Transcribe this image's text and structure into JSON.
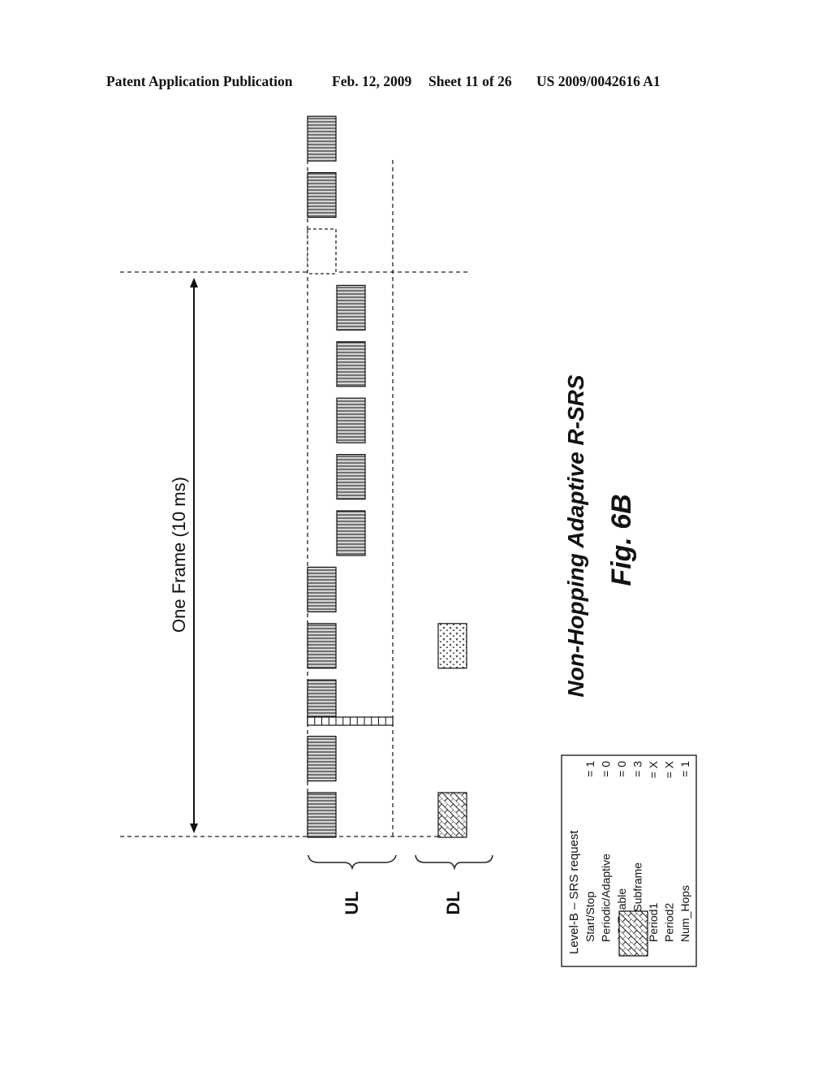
{
  "header": {
    "publication": "Patent Application Publication",
    "date": "Feb. 12, 2009",
    "sheet": "Sheet 11 of 26",
    "number": "US 2009/0042616 A1"
  },
  "figure": {
    "frame_label": "One Frame (10 ms)",
    "title": "Non-Hopping Adaptive R-SRS",
    "fig_label": "Fig. 6B",
    "ul_label": "UL",
    "dl_label": "DL",
    "ul_subframes": [
      {
        "index": 0,
        "lane": "upper",
        "style": "vertical-hatch"
      },
      {
        "index": 1,
        "lane": "upper",
        "style": "vertical-hatch"
      },
      {
        "index": 2,
        "lane": "upper",
        "style": "vertical-hatch"
      },
      {
        "index": 3,
        "lane": "upper",
        "style": "vertical-hatch"
      },
      {
        "index": 4,
        "lane": "upper",
        "style": "vertical-hatch"
      },
      {
        "index": 5,
        "lane": "lower",
        "style": "vertical-hatch"
      },
      {
        "index": 6,
        "lane": "lower",
        "style": "vertical-hatch"
      },
      {
        "index": 7,
        "lane": "lower",
        "style": "vertical-hatch"
      },
      {
        "index": 8,
        "lane": "lower",
        "style": "vertical-hatch"
      },
      {
        "index": 9,
        "lane": "lower",
        "style": "vertical-hatch"
      },
      {
        "index": 10,
        "lane": "upper",
        "style": "dashed-empty"
      },
      {
        "index": 11,
        "lane": "upper",
        "style": "vertical-hatch"
      },
      {
        "index": 12,
        "lane": "upper",
        "style": "vertical-hatch"
      }
    ],
    "srs_bar_after_subframe": 1,
    "srs_bar_cells": 12,
    "dl_subframes": [
      {
        "index": 0,
        "style": "brick-hatch"
      },
      {
        "index": 3,
        "style": "dotted"
      }
    ],
    "legend": {
      "title": "Level-B – SRS request",
      "rows": [
        {
          "name": "Start/Stop",
          "value": "= 1"
        },
        {
          "name": "Periodic/Adaptive",
          "value": "= 0"
        },
        {
          "name": "AS Enable",
          "value": "= 0"
        },
        {
          "name": "Start_Subframe",
          "value": "= 3"
        },
        {
          "name": "Period1",
          "value": "= X"
        },
        {
          "name": "Period2",
          "value": "= X"
        },
        {
          "name": "Num_Hops",
          "value": "= 1"
        }
      ],
      "swatch": "brick-hatch"
    }
  }
}
